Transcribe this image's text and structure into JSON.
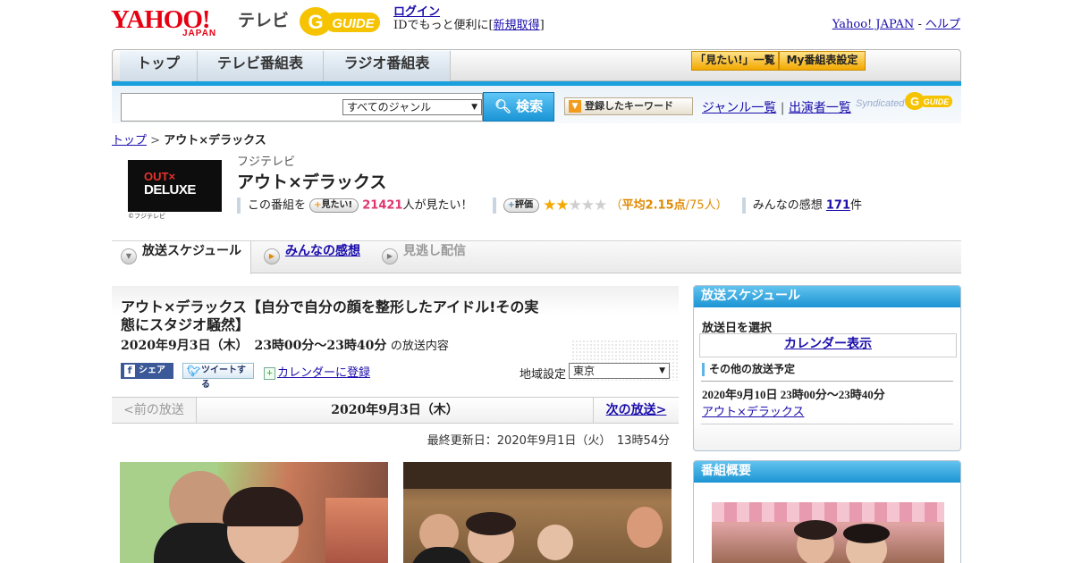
{
  "header": {
    "yahoo_logo_main": "YAHOO!",
    "yahoo_logo_sub": "JAPAN",
    "tv_label": "テレビ",
    "gguide_logo": "G-GUIDE",
    "login_link": "ログイン",
    "login_prompt_prefix": "IDでもっと便利に[",
    "signup_link": "新規取得",
    "login_prompt_suffix": "]",
    "yahoo_japan_link": "Yahoo! JAPAN",
    "separator": " - ",
    "help_link": "ヘルプ"
  },
  "nav": {
    "tabs": [
      {
        "label": "トップ"
      },
      {
        "label": "テレビ番組表"
      },
      {
        "label": "ラジオ番組表"
      }
    ],
    "want_list_button": "「見たい!」一覧",
    "my_schedule_button": "My番組表設定"
  },
  "search": {
    "query": "",
    "genre_selected": "すべてのジャンル",
    "search_button": "検索",
    "keyword_button": "登録したキーワード",
    "genre_list_link": "ジャンル一覧",
    "divider": "|",
    "cast_list_link": "出演者一覧",
    "syndicated_label": "Syndicated"
  },
  "breadcrumb": {
    "home": "トップ",
    "arrow": " > ",
    "current": "アウト×デラックス"
  },
  "program": {
    "logo_text_line1": "OUT×",
    "logo_text_line2": "DELUXE",
    "logo_caption": "©フジテレビ",
    "station": "フジテレビ",
    "title": "アウト×デラックス",
    "want_prefix": "この番組を",
    "want_button": "見たい!",
    "want_count": "21421",
    "want_suffix": "人が見たい！",
    "rate_button": "評価",
    "rating_value": 2.15,
    "rating_open": "（",
    "rating_avg": "平均2.15点",
    "rating_count": "/75人）",
    "reviews_prefix": "みんなの感想",
    "reviews_count": "171",
    "reviews_suffix": "件"
  },
  "tabs": [
    {
      "label": "放送スケジュール",
      "state": "active"
    },
    {
      "label": "みんなの感想",
      "state": "link"
    },
    {
      "label": "見逃し配信",
      "state": "disabled"
    }
  ],
  "episode": {
    "title": "アウト×デラックス【自分で自分の顔を整形したアイドル!その実態にスタジオ騒然】",
    "datetime": "2020年9月3日（木）　23時00分～23時40分",
    "datetime_suffix": "の放送内容",
    "share_button": "シェア",
    "tweet_button": "ツイートする",
    "calendar_register": "カレンダーに登録",
    "region_label": "地域設定",
    "region_selected": "東京"
  },
  "pager": {
    "prev": "<前の放送",
    "current_date": "2020年9月3日（木）",
    "next": "次の放送>"
  },
  "updated": "最終更新日：2020年9月1日（火）　13時54分",
  "sidebar": {
    "schedule_header": "放送スケジュール",
    "select_date_label": "放送日を選択",
    "calendar_button": "カレンダー表示",
    "other_label": "その他の放送予定",
    "other_time": "2020年9月10日  23時00分～23時40分",
    "other_link": "アウト×デラックス",
    "overview_header": "番組概要"
  },
  "colors": {
    "accent_blue": "#1aa0dc",
    "want_pink": "#e0356e",
    "rating_orange": "#e08a00",
    "yahoo_red": "#e60012",
    "gguide_yellow": "#f5c300"
  }
}
